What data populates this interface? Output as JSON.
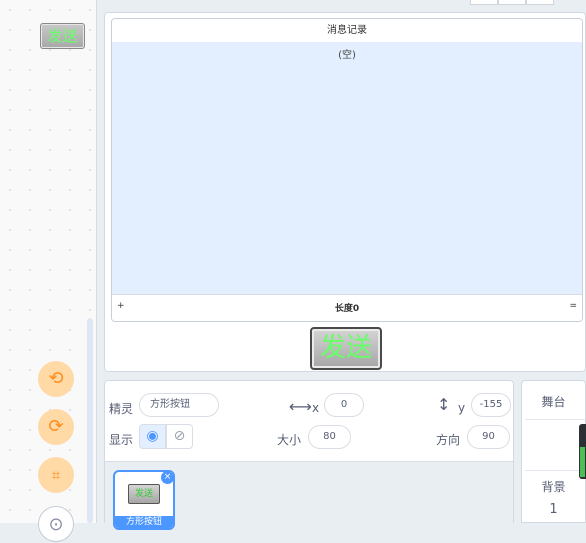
{
  "code_area": {
    "send_block_label": "发送"
  },
  "zoom": {
    "zoom_in_icon": "rotate-left-icon",
    "zoom_out_icon": "rotate-right-icon",
    "crop_icon": "crop-icon",
    "reset_icon": "zoom-reset-icon"
  },
  "stage": {
    "list_monitor": {
      "title": "消息记录",
      "empty_text": "(空)",
      "add_label": "+",
      "length_label": "长度0",
      "resize_label": "="
    },
    "sprite_button_label": "发送"
  },
  "sprite_info": {
    "sprite_label": "精灵",
    "sprite_name": "方形按钮",
    "x_label": "x",
    "x_value": "0",
    "y_label": "y",
    "y_value": "-155",
    "show_label": "显示",
    "size_label": "大小",
    "size_value": "80",
    "direction_label": "方向",
    "direction_value": "90"
  },
  "sprite_list": {
    "items": [
      {
        "thumb_label": "发送",
        "name": "方形按钮",
        "selected": true
      }
    ]
  },
  "stage_selector": {
    "title": "舞台",
    "backdrop_label": "背景",
    "backdrop_count": "1"
  },
  "colors": {
    "accent": "#4c97ff",
    "list_bg": "#e3efff",
    "send_text": "#66ff66",
    "zoom_btn": "#ffd9a6"
  }
}
